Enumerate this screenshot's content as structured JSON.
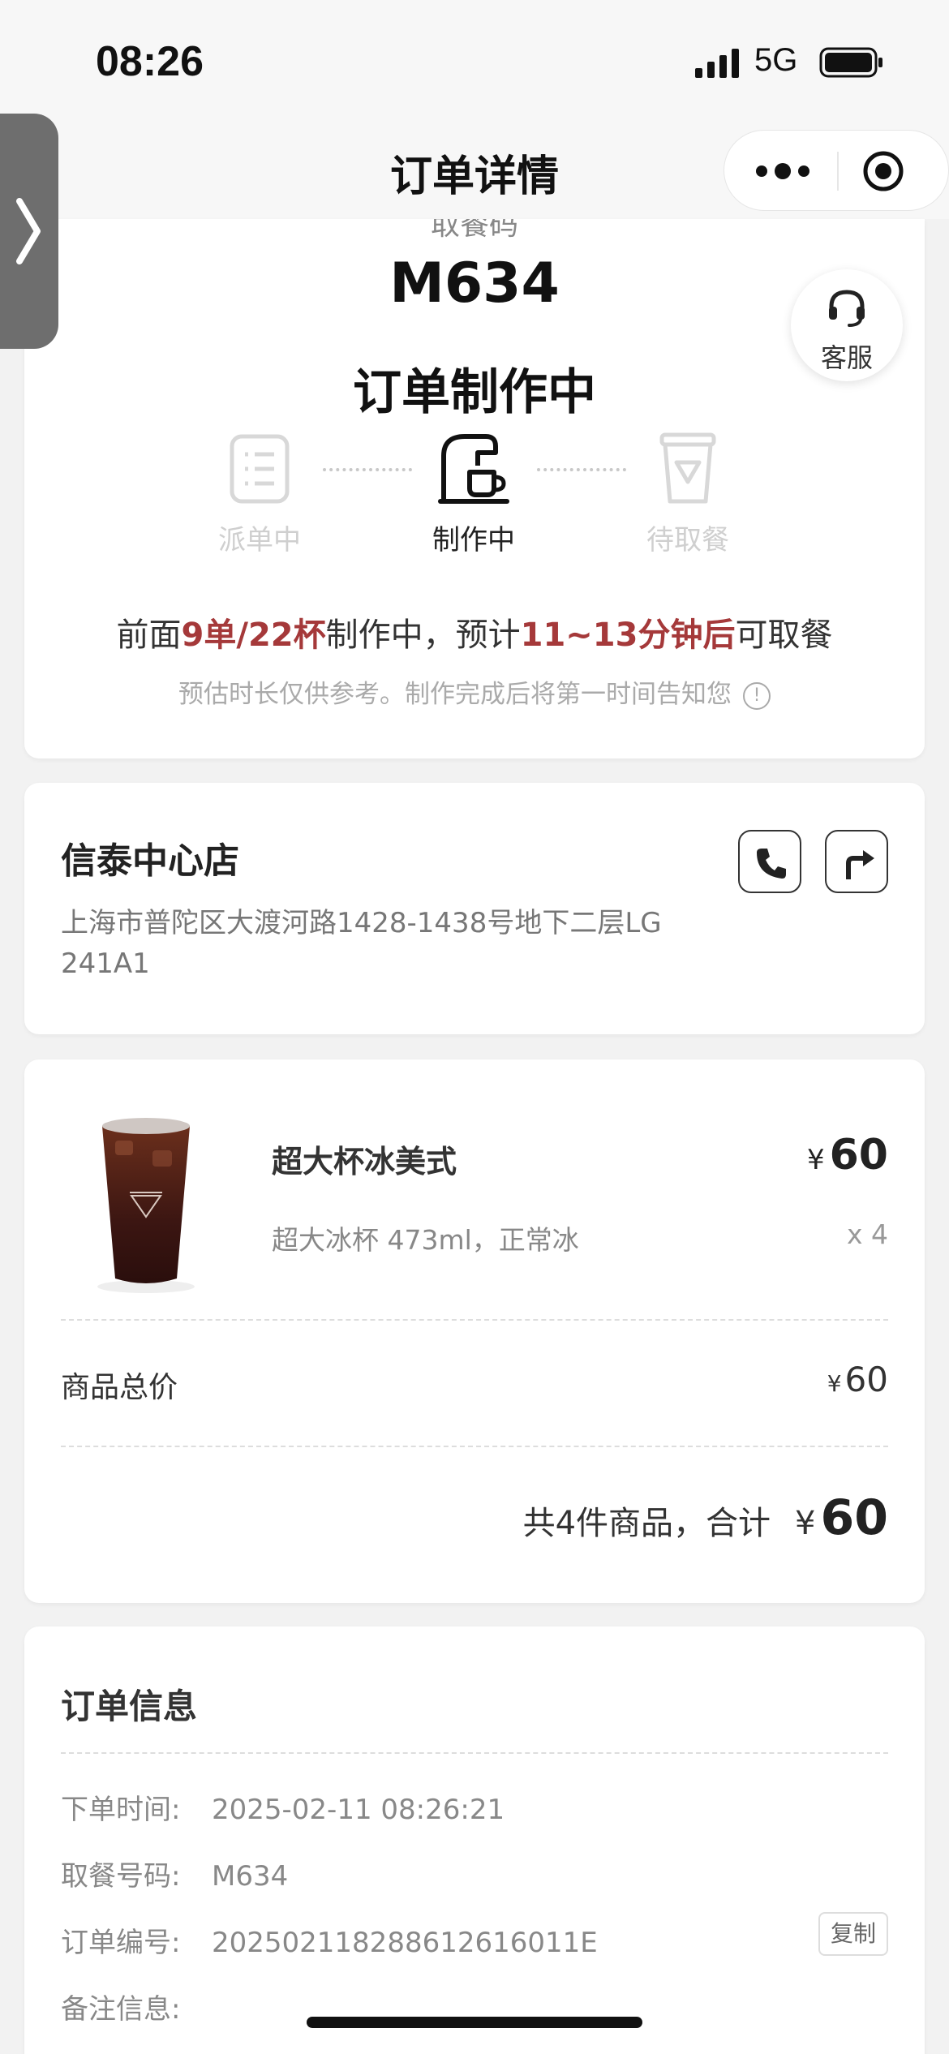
{
  "status_bar": {
    "time": "08:26",
    "network": "5G"
  },
  "nav": {
    "title": "订单详情"
  },
  "order": {
    "pickup_label": "取餐码",
    "pickup_code": "M634",
    "status_title": "订单制作中",
    "steps": [
      {
        "label": "派单中",
        "state": "done"
      },
      {
        "label": "制作中",
        "state": "active"
      },
      {
        "label": "待取餐",
        "state": "pending"
      }
    ],
    "queue": {
      "prefix": "前面",
      "count": "9单/22杯",
      "middle": "制作中，预计",
      "eta": "11~13分钟后",
      "suffix": "可取餐"
    },
    "note": "预估时长仅供参考。制作完成后将第一时间告知您",
    "note_icon": "!"
  },
  "service": {
    "label": "客服"
  },
  "store": {
    "name": "信泰中心店",
    "address": "上海市普陀区大渡河路1428-1438号地下二层LG 241A1"
  },
  "product": {
    "name": "超大杯冰美式",
    "spec": "超大冰杯 473ml，正常冰",
    "currency": "¥",
    "price": "60",
    "qty": "x 4"
  },
  "summary": {
    "subtotal_label": "商品总价",
    "subtotal_currency": "¥",
    "subtotal": "60",
    "total_text": "共4件商品，合计",
    "total_currency": "¥",
    "total": "60"
  },
  "order_info": {
    "title": "订单信息",
    "rows": [
      {
        "key": "下单时间:",
        "value": "2025-02-11 08:26:21"
      },
      {
        "key": "取餐号码:",
        "value": "M634"
      },
      {
        "key": "订单编号:",
        "value": "202502118288612616011E"
      },
      {
        "key": "备注信息:",
        "value": ""
      }
    ],
    "copy_label": "复制"
  },
  "colors": {
    "accent_red": "#a5393a",
    "inactive": "#c8c8c8"
  }
}
